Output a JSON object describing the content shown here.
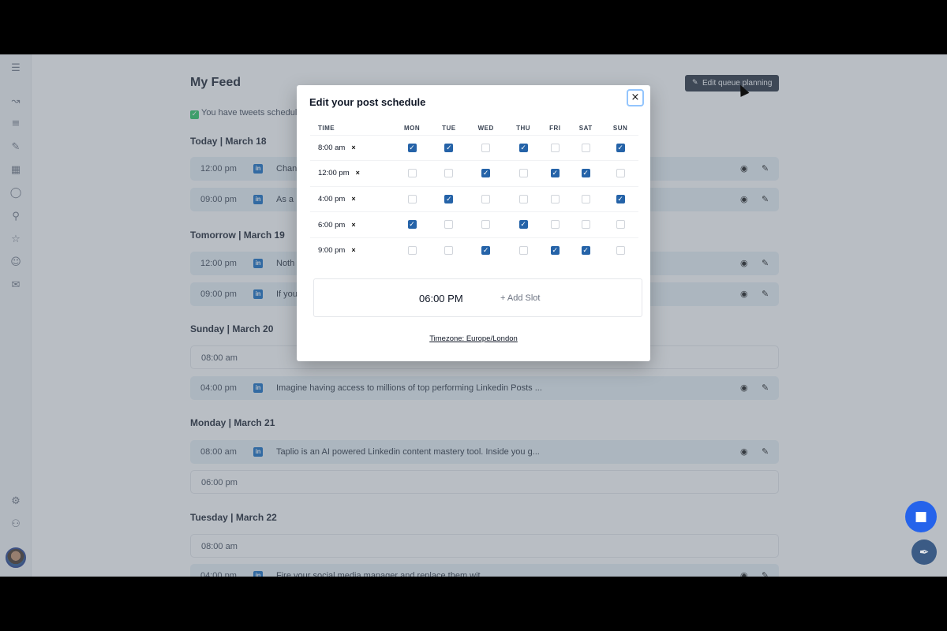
{
  "page": {
    "title": "My Feed",
    "edit_queue_label": "Edit queue planning",
    "notice": "You have tweets schedul"
  },
  "feed": {
    "days": [
      {
        "header": "Today | March 18",
        "slots": [
          {
            "time": "12:00 pm",
            "text": "Chan",
            "filled": true
          },
          {
            "time": "09:00 pm",
            "text": "As a",
            "filled": true
          }
        ]
      },
      {
        "header": "Tomorrow | March 19",
        "slots": [
          {
            "time": "12:00 pm",
            "text": "Noth",
            "filled": true
          },
          {
            "time": "09:00 pm",
            "text": "If you",
            "filled": true
          }
        ]
      },
      {
        "header": "Sunday | March 20",
        "slots": [
          {
            "time": "08:00 am",
            "text": "",
            "filled": false
          },
          {
            "time": "04:00 pm",
            "text": "Imagine having access to millions of top performing Linkedin Posts ...",
            "filled": true
          }
        ]
      },
      {
        "header": "Monday | March 21",
        "slots": [
          {
            "time": "08:00 am",
            "text": "Taplio is an AI powered Linkedin content mastery tool. Inside you g...",
            "filled": true
          },
          {
            "time": "06:00 pm",
            "text": "",
            "filled": false
          }
        ]
      },
      {
        "header": "Tuesday | March 22",
        "slots": [
          {
            "time": "08:00 am",
            "text": "",
            "filled": false
          },
          {
            "time": "04:00 pm",
            "text": "Fire your social media manager and replace them wit",
            "filled": true
          }
        ]
      }
    ]
  },
  "modal": {
    "title": "Edit your post schedule",
    "close_label": "×",
    "columns": [
      "TIME",
      "MON",
      "TUE",
      "WED",
      "THU",
      "FRI",
      "SAT",
      "SUN"
    ],
    "rows": [
      {
        "time": "8:00 am",
        "checks": [
          true,
          true,
          false,
          true,
          false,
          false,
          true
        ]
      },
      {
        "time": "12:00 pm",
        "checks": [
          false,
          false,
          true,
          false,
          true,
          true,
          false
        ]
      },
      {
        "time": "4:00 pm",
        "checks": [
          false,
          true,
          false,
          false,
          false,
          false,
          true
        ]
      },
      {
        "time": "6:00 pm",
        "checks": [
          true,
          false,
          false,
          true,
          false,
          false,
          false
        ]
      },
      {
        "time": "9:00 pm",
        "checks": [
          false,
          false,
          true,
          false,
          true,
          true,
          false
        ]
      }
    ],
    "remove_label": "×",
    "new_slot_time": "06:00 PM",
    "add_slot_label": "+ Add Slot",
    "timezone": "Timezone: Europe/London"
  },
  "icons": {
    "sidebar": [
      "menu-icon",
      "chart-icon",
      "list-icon",
      "pen-icon",
      "grid-icon",
      "bulb-icon",
      "search-icon",
      "star-icon",
      "users-icon",
      "chat-icon",
      "gear-icon",
      "bot-icon"
    ],
    "linkedin": "linkedin-icon",
    "accent": "#2563a8",
    "linkedin_color": "#0a66c2"
  }
}
